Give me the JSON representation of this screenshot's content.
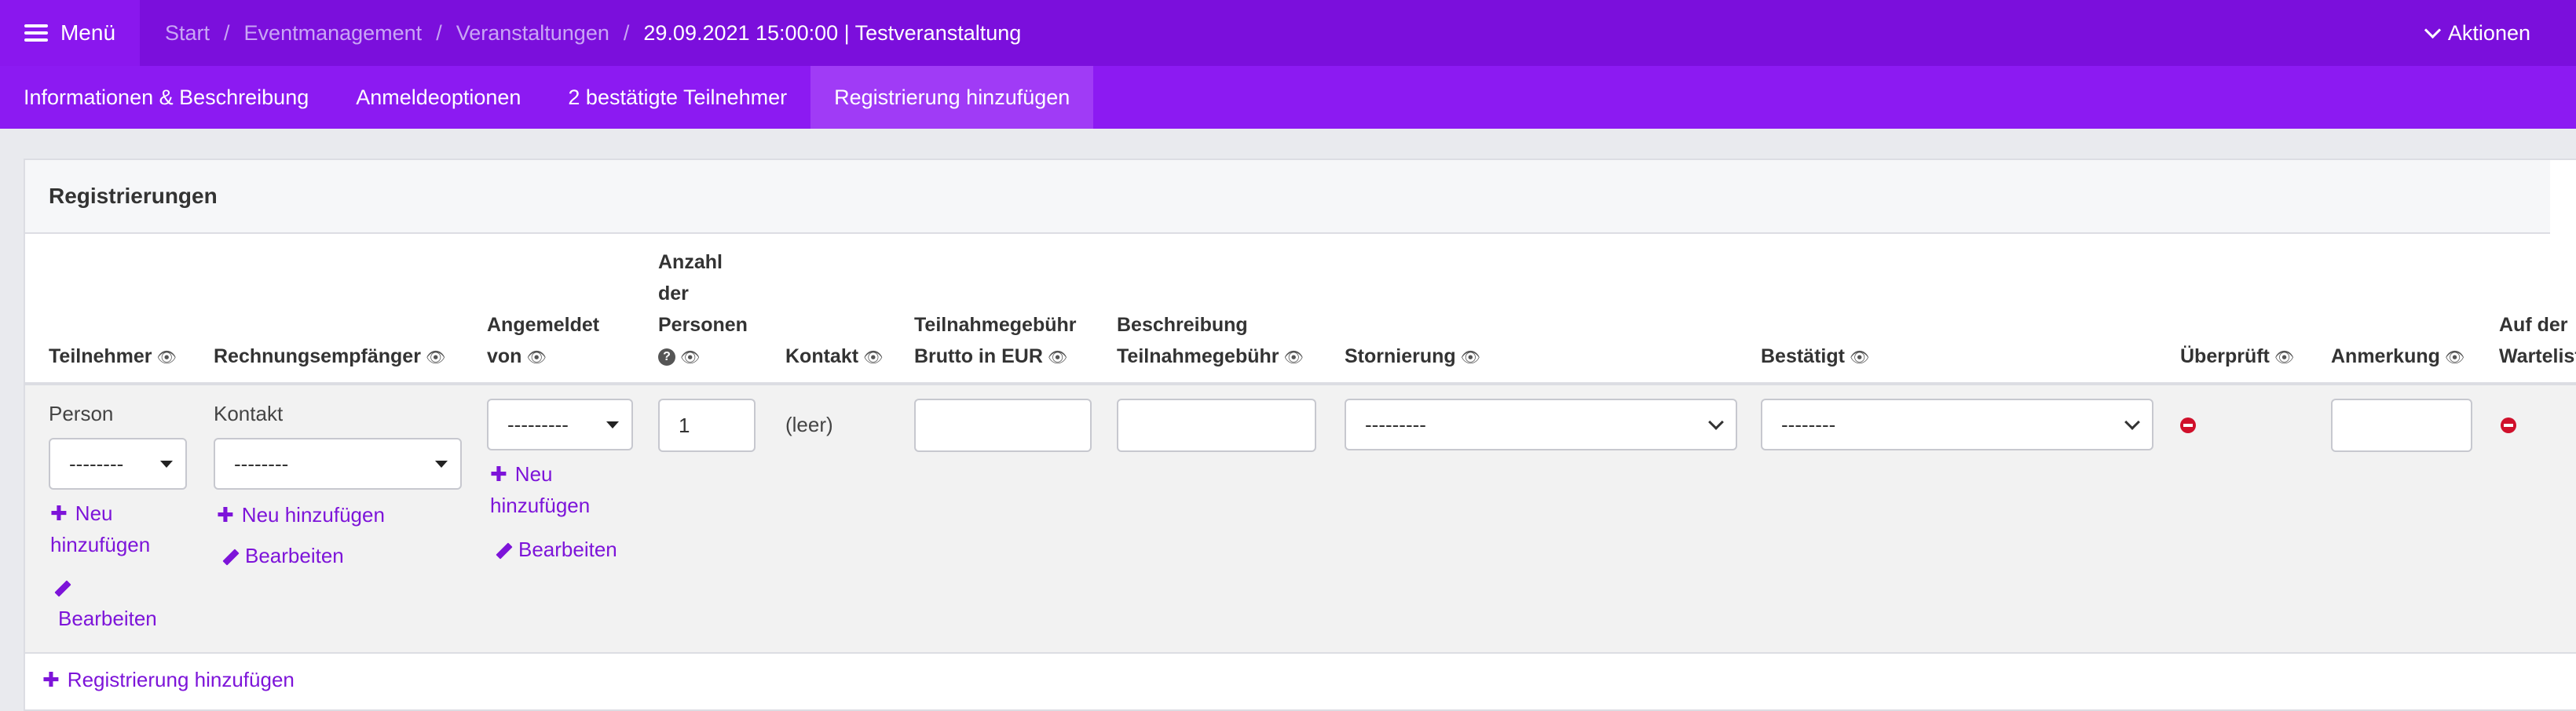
{
  "topbar": {
    "menu_label": "Menü",
    "breadcrumb": [
      "Start",
      "Eventmanagement",
      "Veranstaltungen",
      "29.09.2021 15:00:00 | Testveranstaltung"
    ],
    "separator": "/",
    "actions_label": "Aktionen"
  },
  "tabs": [
    {
      "label": "Informationen & Beschreibung",
      "active": false
    },
    {
      "label": "Anmeldeoptionen",
      "active": false
    },
    {
      "label": "2 bestätigte Teilnehmer",
      "active": false
    },
    {
      "label": "Registrierung hinzufügen",
      "active": true
    }
  ],
  "section": {
    "title": "Registrierungen"
  },
  "columns": {
    "teilnehmer": "Teilnehmer",
    "rechnungsempfaenger": "Rechnungsempfänger",
    "angemeldet_1": "Angemeldet",
    "angemeldet_2": "von",
    "anzahl_1": "Anzahl",
    "anzahl_2": "der",
    "anzahl_3": "Personen",
    "kontakt": "Kontakt",
    "gebuehr_1": "Teilnahmegebühr",
    "gebuehr_2": "Brutto in EUR",
    "beschreibung_1": "Beschreibung",
    "beschreibung_2": "Teilnahmegebühr",
    "stornierung": "Stornierung",
    "bestaetigt": "Bestätigt",
    "ueberprueft": "Überprüft",
    "anmerkung": "Anmerkung",
    "warteliste_1": "Auf der",
    "warteliste_2": "Warteliste"
  },
  "row": {
    "person_label": "Person",
    "person_select": "--------",
    "kontakt_label": "Kontakt",
    "kontakt_select": "--------",
    "angemeldet_select": "---------",
    "anzahl_value": "1",
    "kontakt_value": "(leer)",
    "stornierung_select": "---------",
    "bestaetigt_select": "--------",
    "neu_1": "Neu",
    "neu_2": "hinzufügen",
    "neu_full": "Neu hinzufügen",
    "bearbeiten": "Bearbeiten"
  },
  "footer": {
    "add_registration": "Registrierung hinzufügen"
  },
  "colors": {
    "topbar": "#7b0fdc",
    "tabbar": "#8c1af2",
    "accent": "#7d14d9",
    "danger": "#d0102b"
  }
}
